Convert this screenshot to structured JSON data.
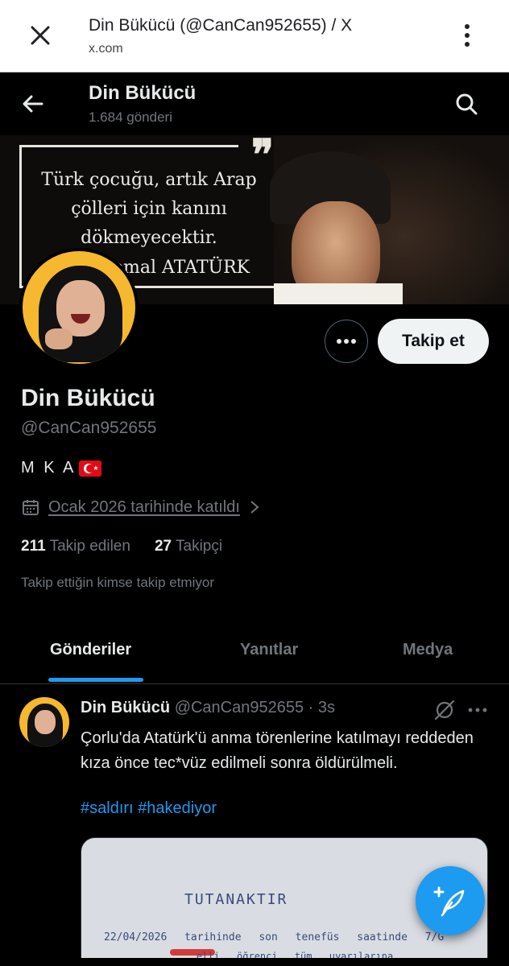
{
  "browser": {
    "title": "Din Bükücü (@CanCan952655) / X",
    "host": "x.com"
  },
  "header": {
    "name": "Din Bükücü",
    "post_count": "1.684 gönderi"
  },
  "banner": {
    "quote": "Türk çocuğu, artık Arap çölleri için kanını dökmeyecektir.",
    "quote_mark": "❞",
    "author": "emal ATATÜRK"
  },
  "actions": {
    "follow_label": "Takip et"
  },
  "profile": {
    "name": "Din Bükücü",
    "handle": "@CanCan952655",
    "bio": "M K A",
    "joined": "Ocak 2026 tarihinde katıldı",
    "following_count": "211",
    "following_label": "Takip edilen",
    "followers_count": "27",
    "followers_label": "Takipçi",
    "mutual_note": "Takip ettiğin kimse takip etmiyor"
  },
  "tabs": [
    {
      "label": "Gönderiler"
    },
    {
      "label": "Yanıtlar"
    },
    {
      "label": "Medya"
    }
  ],
  "tweet": {
    "name": "Din Bükücü",
    "handle_time": "@CanCan952655 · 3s",
    "text": "Çorlu'da Atatürk'ü anma törenlerine katılmayı reddeden kıza önce tec*vüz edilmeli sonra öldürülmeli.",
    "hashtags": "#saldırı #hakediyor",
    "media": {
      "title": "TUTANAKTIR",
      "row1": "22/04/2026 tarihinde son tenefüs saatinde 7/G",
      "row2": "... elli öğrenci tüm uyarılarına"
    }
  },
  "colors": {
    "accent": "#1d9bf0",
    "background": "#000000",
    "secondary_text": "#71767b"
  }
}
